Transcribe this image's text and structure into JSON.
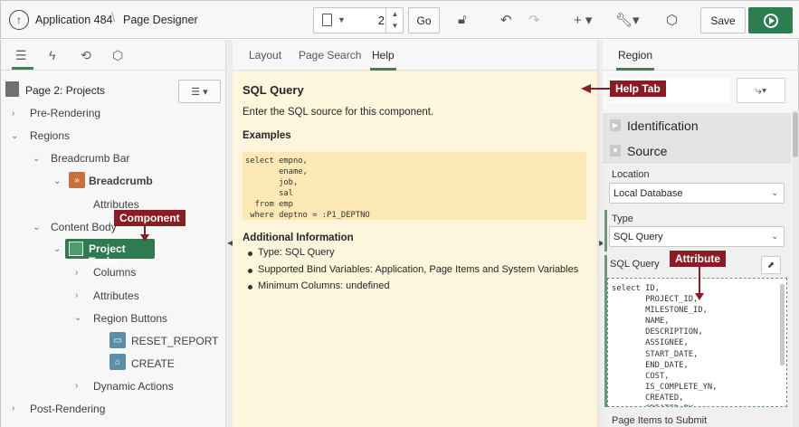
{
  "header": {
    "app_name": "Application 484",
    "page_designer": "Page Designer",
    "page_number": "2",
    "go_label": "Go",
    "save_label": "Save"
  },
  "left": {
    "page_title": "Page 2: Projects",
    "tree": {
      "pre_rendering": "Pre-Rendering",
      "regions": "Regions",
      "breadcrumb_bar": "Breadcrumb Bar",
      "breadcrumb": "Breadcrumb",
      "attributes1": "Attributes",
      "content_body": "Content Body",
      "project_tasks": "Project Tasks",
      "columns": "Columns",
      "attributes2": "Attributes",
      "region_buttons": "Region Buttons",
      "reset_report": "RESET_REPORT",
      "create": "CREATE",
      "dynamic_actions": "Dynamic Actions",
      "post_rendering": "Post-Rendering"
    }
  },
  "callouts": {
    "component": "Component",
    "help_tab": "Help Tab",
    "attribute": "Attribute"
  },
  "center": {
    "tabs": [
      "Layout",
      "Page Search",
      "Help"
    ],
    "help_title": "SQL Query",
    "help_desc": "Enter the SQL source for this component.",
    "examples_heading": "Examples",
    "example_code": "select empno,\n       ename,\n       job,\n       sal\n  from emp\n where deptno = :P1_DEPTNO",
    "additional_heading": "Additional Information",
    "bullets": [
      "Type: SQL Query",
      "Supported Bind Variables: Application, Page Items and System Variables",
      "Minimum Columns: undefined"
    ]
  },
  "right": {
    "tab": "Region",
    "identification": "Identification",
    "source": "Source",
    "location_label": "Location",
    "location_value": "Local Database",
    "type_label": "Type",
    "type_value": "SQL Query",
    "sql_label": "SQL Query",
    "sql_code": "select ID,\n       PROJECT_ID,\n       MILESTONE_ID,\n       NAME,\n       DESCRIPTION,\n       ASSIGNEE,\n       START_DATE,\n       END_DATE,\n       COST,\n       IS_COMPLETE_YN,\n       CREATED,\n       CREATED_BY",
    "page_items_label": "Page Items to Submit"
  },
  "colors": {
    "accent_green": "#2f7a50",
    "callout_red": "#8b1c24",
    "help_bg": "#fdf6dc",
    "breadcrumb_badge": "#c9703c",
    "button_badge": "#5b8fa8"
  }
}
